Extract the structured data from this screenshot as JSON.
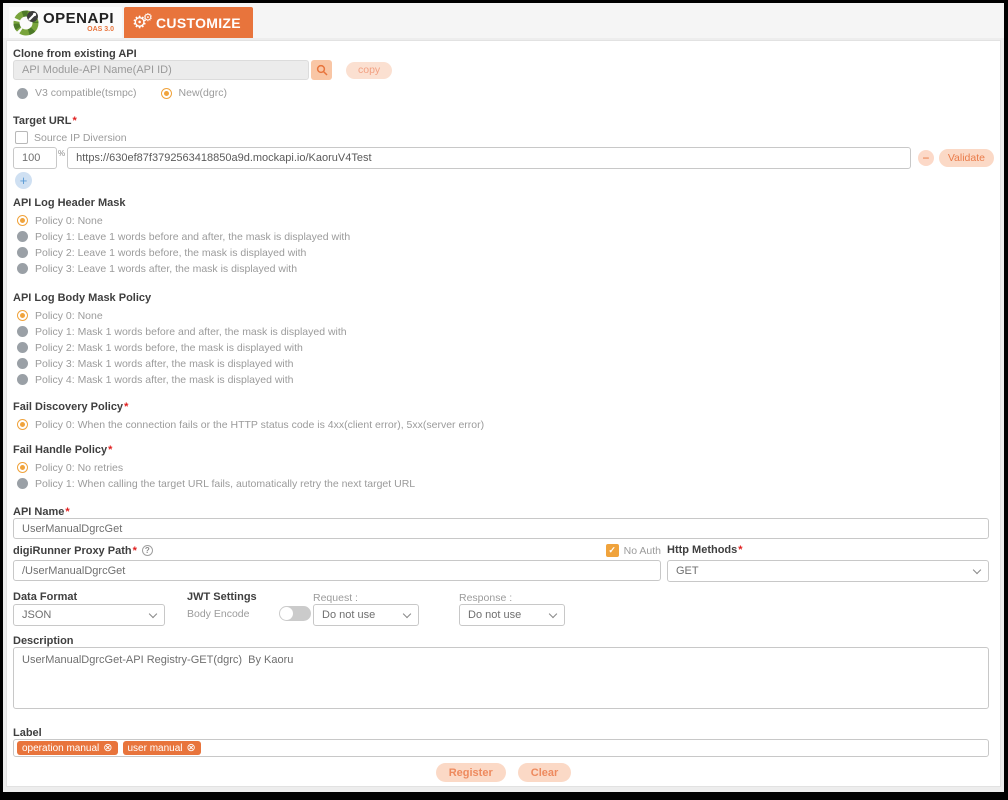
{
  "header": {
    "logo_title": "OPENAPI",
    "logo_subtitle": "OAS 3.0",
    "customize_tab": "CUSTOMIZE"
  },
  "misc": {
    "required_mark": "*",
    "question_mark": "?",
    "check_mark": "✓",
    "plus": "+",
    "minus": "−",
    "gear": "⚙"
  },
  "clone": {
    "label": "Clone from existing API",
    "placeholder": "API Module-API Name(API ID)",
    "copy_label": "copy",
    "radios": [
      {
        "label": "V3 compatible(tsmpc)",
        "selected": false
      },
      {
        "label": "New(dgrc)",
        "selected": true
      }
    ]
  },
  "target_url": {
    "label": "Target URL",
    "source_ip_label": "Source IP Diversion",
    "weight_value": "100",
    "percent": "%",
    "url_value": "https://630ef87f3792563418850a9d.mockapi.io/KaoruV4Test",
    "validate_label": "Validate"
  },
  "header_mask": {
    "label": "API Log Header Mask",
    "options": [
      {
        "label": "Policy 0: None",
        "selected": true
      },
      {
        "label": "Policy 1: Leave 1 words before and after, the mask is displayed with",
        "selected": false
      },
      {
        "label": "Policy 2: Leave 1 words before, the mask is displayed with",
        "selected": false
      },
      {
        "label": "Policy 3: Leave 1 words after, the mask is displayed with",
        "selected": false
      }
    ]
  },
  "body_mask": {
    "label": "API Log Body Mask Policy",
    "options": [
      {
        "label": "Policy 0: None",
        "selected": true
      },
      {
        "label": "Policy 1: Mask 1 words before and after, the mask is displayed with",
        "selected": false
      },
      {
        "label": "Policy 2: Mask 1 words before, the mask is displayed with",
        "selected": false
      },
      {
        "label": "Policy 3: Mask 1 words after, the mask is displayed with",
        "selected": false
      },
      {
        "label": "Policy 4: Mask 1 words after, the mask is displayed with",
        "selected": false
      }
    ]
  },
  "fail_discovery": {
    "label": "Fail Discovery Policy",
    "options": [
      {
        "label": "Policy 0: When the connection fails or the HTTP status code is 4xx(client error), 5xx(server error)",
        "selected": true
      }
    ]
  },
  "fail_handle": {
    "label": "Fail Handle Policy",
    "options": [
      {
        "label": "Policy 0: No retries",
        "selected": true
      },
      {
        "label": "Policy 1: When calling the target URL fails, automatically retry the next target URL",
        "selected": false
      }
    ]
  },
  "api_name": {
    "label": "API Name",
    "value": "UserManualDgrcGet"
  },
  "proxy": {
    "label": "digiRunner Proxy Path",
    "no_auth_label": "No Auth",
    "value": "/UserManualDgrcGet",
    "http_methods_label": "Http Methods",
    "http_method_value": "GET"
  },
  "data_format": {
    "label": "Data Format",
    "value": "JSON"
  },
  "jwt": {
    "label": "JWT Settings",
    "body_encode_label": "Body Encode",
    "request_label": "Request :",
    "request_value": "Do not use",
    "response_label": "Response :",
    "response_value": "Do not use"
  },
  "description": {
    "label": "Description",
    "value": "UserManualDgrcGet-API Registry-GET(dgrc)  By Kaoru"
  },
  "tags": {
    "label": "Label",
    "remove_icon": "⊗",
    "items": [
      "operation manual",
      "user manual"
    ]
  },
  "actions": {
    "register_label": "Register",
    "clear_label": "Clear"
  },
  "colors": {
    "accent_orange": "#e8743c",
    "amber_control": "#f0a33c",
    "pill_bg": "#fbd9c6",
    "pill_text": "#ee8a5e",
    "plus_blue": "#5b9bd5"
  }
}
